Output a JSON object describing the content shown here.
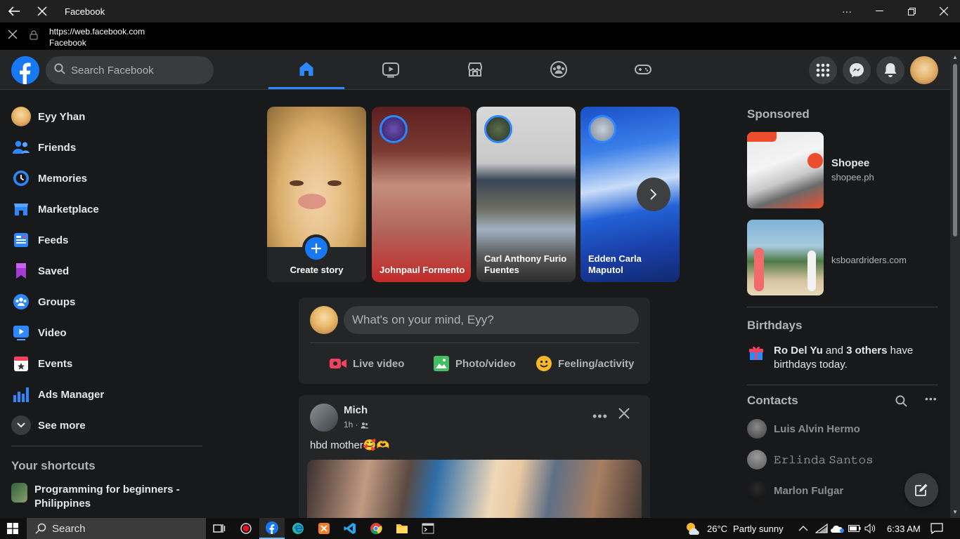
{
  "window": {
    "title": "Facebook"
  },
  "urlbar": {
    "url": "https://web.facebook.com",
    "site": "Facebook"
  },
  "header": {
    "search_placeholder": "Search Facebook"
  },
  "sidebar": {
    "items": [
      {
        "label": "Eyy Yhan"
      },
      {
        "label": "Friends"
      },
      {
        "label": "Memories"
      },
      {
        "label": "Marketplace"
      },
      {
        "label": "Feeds"
      },
      {
        "label": "Saved"
      },
      {
        "label": "Groups"
      },
      {
        "label": "Video"
      },
      {
        "label": "Events"
      },
      {
        "label": "Ads Manager"
      },
      {
        "label": "See more"
      }
    ],
    "shortcuts_title": "Your shortcuts",
    "shortcuts": [
      {
        "label": "Programming for beginners - Philippines"
      }
    ]
  },
  "stories": [
    {
      "label": "Create story"
    },
    {
      "label": "Johnpaul Formento"
    },
    {
      "label": "Carl Anthony Furio Fuentes"
    },
    {
      "label": "Edden Carla Maputol"
    }
  ],
  "composer": {
    "placeholder": "What's on your mind, Eyy?",
    "actions": [
      {
        "label": "Live video",
        "color": "#f3425f"
      },
      {
        "label": "Photo/video",
        "color": "#45bd62"
      },
      {
        "label": "Feeling/activity",
        "color": "#f7b928"
      }
    ]
  },
  "post": {
    "author": "Mich",
    "time": "1h ·",
    "text": "hbd mother🥰🫶"
  },
  "right": {
    "sponsored_title": "Sponsored",
    "ads": [
      {
        "name": "Shopee",
        "domain": "shopee.ph"
      },
      {
        "domain": "ksboardriders.com"
      }
    ],
    "birthdays_title": "Birthdays",
    "birthday_name": "Ro Del Yu",
    "birthday_and": "and",
    "birthday_others": "3 others",
    "birthday_suffix": "have birthdays today.",
    "contacts_title": "Contacts",
    "contacts": [
      {
        "name": "Luis Alvin Hermo"
      },
      {
        "name": "𝙴𝚛𝚕𝚒𝚗𝚍𝚊 𝚂𝚊𝚗𝚝𝚘𝚜"
      },
      {
        "name": "Marlon Fulgar"
      }
    ]
  },
  "taskbar": {
    "search": "Search",
    "weather_temp": "26°C",
    "weather_desc": "Partly sunny",
    "time": "6:33 AM"
  },
  "colors": {
    "accent": "#2d88ff",
    "brand": "#1877f2",
    "bg": "#18191a",
    "card": "#242526"
  }
}
